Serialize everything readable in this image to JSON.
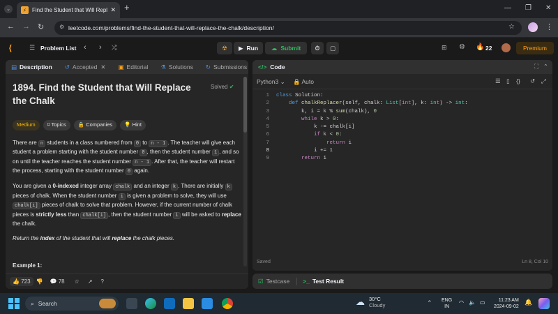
{
  "browser": {
    "tab_title": "Find the Student that Will Repl",
    "url": "leetcode.com/problems/find-the-student-that-will-replace-the-chalk/description/"
  },
  "nav": {
    "problem_list": "Problem List",
    "run": "Run",
    "submit": "Submit",
    "streak": "22",
    "premium": "Premium"
  },
  "desc_tabs": [
    "Description",
    "Accepted",
    "Editorial",
    "Solutions",
    "Submissions"
  ],
  "problem": {
    "title_l1": "1894. Find the Student that Will Replace",
    "title_l2": "the Chalk",
    "status": "Solved",
    "tags": [
      "Medium",
      "Topics",
      "Companies",
      "Hint"
    ],
    "p1": [
      [
        "There are ",
        ""
      ],
      [
        "n",
        "code"
      ],
      [
        " students in a class numbered from ",
        ""
      ],
      [
        "0",
        "code"
      ],
      [
        " to ",
        ""
      ],
      [
        "n - 1",
        "code"
      ],
      [
        ". The teacher will give each student a problem starting with the student number ",
        ""
      ],
      [
        "0",
        "code"
      ],
      [
        ", then the student number ",
        ""
      ],
      [
        "1",
        "code"
      ],
      [
        ", and so on until the teacher reaches the student number ",
        ""
      ],
      [
        "n - 1",
        "code"
      ],
      [
        ". After that, the teacher will restart the process, starting with the student number ",
        ""
      ],
      [
        "0",
        "code"
      ],
      [
        " again.",
        ""
      ]
    ],
    "p2": [
      [
        "You are given a ",
        ""
      ],
      [
        "0-indexed",
        "b"
      ],
      [
        " integer array ",
        ""
      ],
      [
        "chalk",
        "code"
      ],
      [
        " and an integer ",
        ""
      ],
      [
        "k",
        "code"
      ],
      [
        ". There are initially ",
        ""
      ],
      [
        "k",
        "code"
      ],
      [
        " pieces of chalk. When the student number ",
        ""
      ],
      [
        "i",
        "code"
      ],
      [
        " is given a problem to solve, they will use ",
        ""
      ],
      [
        "chalk[i]",
        "code"
      ],
      [
        " pieces of chalk to solve that problem. However, if the current number of chalk pieces is ",
        ""
      ],
      [
        "strictly less",
        "b"
      ],
      [
        " than ",
        ""
      ],
      [
        "chalk[i]",
        "code"
      ],
      [
        ", then the student number ",
        ""
      ],
      [
        "i",
        "code"
      ],
      [
        " will be asked to ",
        ""
      ],
      [
        "replace",
        "b"
      ],
      [
        " the chalk.",
        ""
      ]
    ],
    "p3": [
      [
        "Return the ",
        "i"
      ],
      [
        "index",
        "bi"
      ],
      [
        " of the student that will ",
        "i"
      ],
      [
        "replace",
        "bi"
      ],
      [
        " the chalk pieces.",
        "i"
      ]
    ],
    "example": "Example 1:",
    "likes": "723",
    "comments": "78"
  },
  "code": {
    "header": "Code",
    "language": "Python3",
    "mode": "Auto",
    "lines": [
      [
        [
          "class ",
          "kw"
        ],
        [
          "Solution:",
          ""
        ]
      ],
      [
        [
          "    def ",
          "kw"
        ],
        [
          "chalkReplacer",
          "fn"
        ],
        [
          "(self, chalk: ",
          ""
        ],
        [
          "List",
          "ty"
        ],
        [
          "[",
          ""
        ],
        [
          "int",
          "ty"
        ],
        [
          "], k: ",
          ""
        ],
        [
          "int",
          "ty"
        ],
        [
          ") -> ",
          ""
        ],
        [
          "int",
          "ty"
        ],
        [
          ":",
          ""
        ]
      ],
      [
        [
          "        k, i = k % ",
          ""
        ],
        [
          "sum",
          "fn"
        ],
        [
          "(chalk), ",
          ""
        ],
        [
          "0",
          "nm"
        ]
      ],
      [
        [
          "        while ",
          "cm"
        ],
        [
          "k > ",
          ""
        ],
        [
          "0",
          "nm"
        ],
        [
          ":",
          ""
        ]
      ],
      [
        [
          "            k -= chalk[i]",
          ""
        ]
      ],
      [
        [
          "            if ",
          "cm"
        ],
        [
          "k < ",
          ""
        ],
        [
          "0",
          "nm"
        ],
        [
          ":",
          ""
        ]
      ],
      [
        [
          "                return ",
          "cm"
        ],
        [
          "i",
          ""
        ]
      ],
      [
        [
          "            i += ",
          ""
        ],
        [
          "1",
          "nm"
        ]
      ],
      [
        [
          "        return ",
          "cm"
        ],
        [
          "i",
          ""
        ]
      ]
    ],
    "saved": "Saved",
    "cursor": "Ln 8, Col 10"
  },
  "bottom_tabs": [
    "Testcase",
    "Test Result"
  ],
  "taskbar": {
    "search": "Search",
    "weather_temp": "30°C",
    "weather_desc": "Cloudy",
    "lang_l1": "ENG",
    "lang_l2": "IN",
    "time": "11:23 AM",
    "date": "2024-09-02"
  },
  "colors": {
    "accent_orange": "#ffa116",
    "run_green": "#2cbb5d",
    "medium": "#ffb800"
  }
}
